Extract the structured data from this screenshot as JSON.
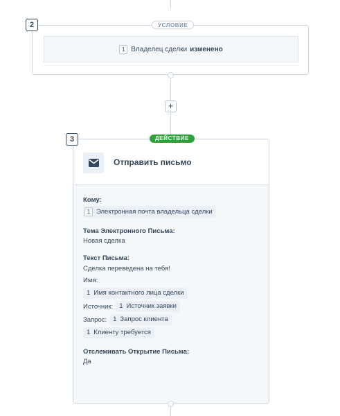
{
  "step2": {
    "number": "2",
    "pill_label": "УСЛОВИЕ",
    "condition": {
      "index": "1",
      "text": "Владелец сделки",
      "bold_text": "изменено"
    }
  },
  "add_step": {
    "label": "+"
  },
  "step3": {
    "number": "3",
    "pill_label": "ДЕЙСТВИЕ",
    "icon": "envelope-icon",
    "title": "Отправить письмо",
    "to": {
      "label": "Кому:",
      "index": "1",
      "value": "Электронная почта владельца сделки"
    },
    "subject": {
      "label": "Тема Электронного Письма:",
      "value": "Новая сделка"
    },
    "body": {
      "label": "Текст Письма:",
      "line1": "Сделка переведена на тебя!",
      "line2": "Имя:",
      "token_name": {
        "index": "1",
        "label": "Имя контактного лица сделки"
      },
      "source_prefix": "Источник:",
      "token_source": {
        "index": "1",
        "label": "Источник заявки"
      },
      "request_prefix": "Запрос:",
      "token_request": {
        "index": "1",
        "label": "Запрос клиента"
      },
      "token_needs": {
        "index": "1",
        "label": "Клиенту требуется"
      }
    },
    "tracking": {
      "label": "Отслеживать Открытие Письма:",
      "value": "Да"
    }
  },
  "colors": {
    "border": "#cbd6e2",
    "action_green": "#31a23a",
    "text": "#33475b",
    "panel_bg": "#f5f8fa",
    "token_bg": "#eaf0f6"
  }
}
